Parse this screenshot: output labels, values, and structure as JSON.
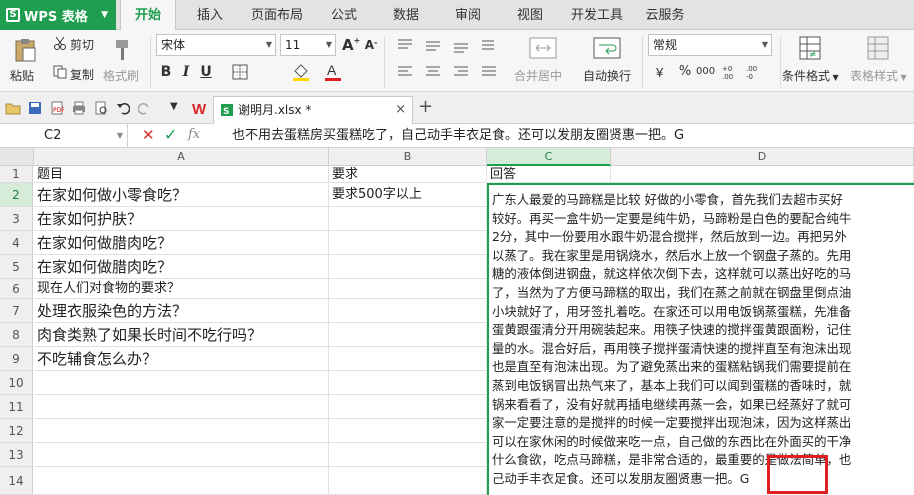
{
  "app": {
    "name": "WPS 表格"
  },
  "menu": {
    "tabs": [
      "开始",
      "插入",
      "页面布局",
      "公式",
      "数据",
      "审阅",
      "视图",
      "开发工具",
      "云服务"
    ],
    "active": "开始"
  },
  "ribbon": {
    "cut": "剪切",
    "paste": "粘贴",
    "copy": "复制",
    "format_painter": "格式刷",
    "font": "宋体",
    "font_size": "11",
    "bold": "B",
    "italic": "I",
    "underline": "U",
    "merge": "合并居中",
    "wrap": "自动换行",
    "number_format": "常规",
    "percent": "%",
    "thousands": "000",
    "cond_format": "条件格式",
    "table_style": "表格样式"
  },
  "document": {
    "tab": "谢明月.xlsx *",
    "add": "+"
  },
  "formula_bar": {
    "cell_ref": "C2",
    "fx": "fx",
    "content": "也不用去蛋糕房买蛋糕吃了，自己动手丰衣足食。还可以发朋友圈贤惠一把。G"
  },
  "columns": [
    "A",
    "B",
    "C",
    "D"
  ],
  "rows": [
    "1",
    "2",
    "3",
    "4",
    "5",
    "6",
    "7",
    "8",
    "9",
    "10",
    "11",
    "12",
    "13",
    "14"
  ],
  "cells": {
    "A1": "题目",
    "B1": "要求",
    "C1": "回答",
    "A2": "在家如何做小零食吃？",
    "B2": "要求500字以上",
    "A3": "在家如何护肤？",
    "A4": "在家如何做腊肉吃？",
    "A5": "在家如何做腊肉吃？",
    "A6": "现在人们对食物的要求？",
    "A7": "处理衣服染色的方法？",
    "A8": "肉食类熟了如果长时间不吃行吗？",
    "A9": "不吃辅食怎么办？"
  },
  "editor_lines": [
    "广东人最爱的马蹄糕是比较 好做的小零食，首先我们去超市买好",
    "较好。再买一盒牛奶一定要是纯牛奶，马蹄粉是白色的要配合纯牛",
    "2分，其中一份要用水跟牛奶混合搅拌，然后放到一边。再把另外",
    "以蒸了。我在家里是用锅烧水，然后水上放一个钢盘子蒸的。先用",
    "糖的液体倒进钢盘，就这样依次倒下去，这样就可以蒸出好吃的马",
    "了，当然为了方便马蹄糕的取出，我们在蒸之前就在钢盘里倒点油",
    "小块就好了，用牙签扎着吃。在家还可以用电饭锅蒸蛋糕，先准备",
    "蛋黄跟蛋清分开用碗装起来。用筷子快速的搅拌蛋黄跟面粉，记住",
    "量的水。混合好后，再用筷子搅拌蛋清快速的搅拌直至有泡沫出现",
    "也是直至有泡沫出现。为了避免蒸出来的蛋糕粘锅我们需要提前在",
    "蒸到电饭锅冒出热气来了，基本上我们可以闻到蛋糕的香味时，就",
    "锅来看看了，没有好就再插电继续再蒸一会，如果已经蒸好了就可",
    "家一定要注意的是搅拌的时候一定要搅拌出现泡沫，因为这样蒸出",
    "可以在家休闲的时候做来吃一点，自己做的东西比在外面买的干净",
    "什么食欲，吃点马蹄糕，是非常合适的，最重要的是做法简单，也",
    "己动手丰衣足食。还可以发朋友圈贤惠一把。G"
  ],
  "accent_color": "#1e9e4e",
  "highlight_color": "#e02020"
}
